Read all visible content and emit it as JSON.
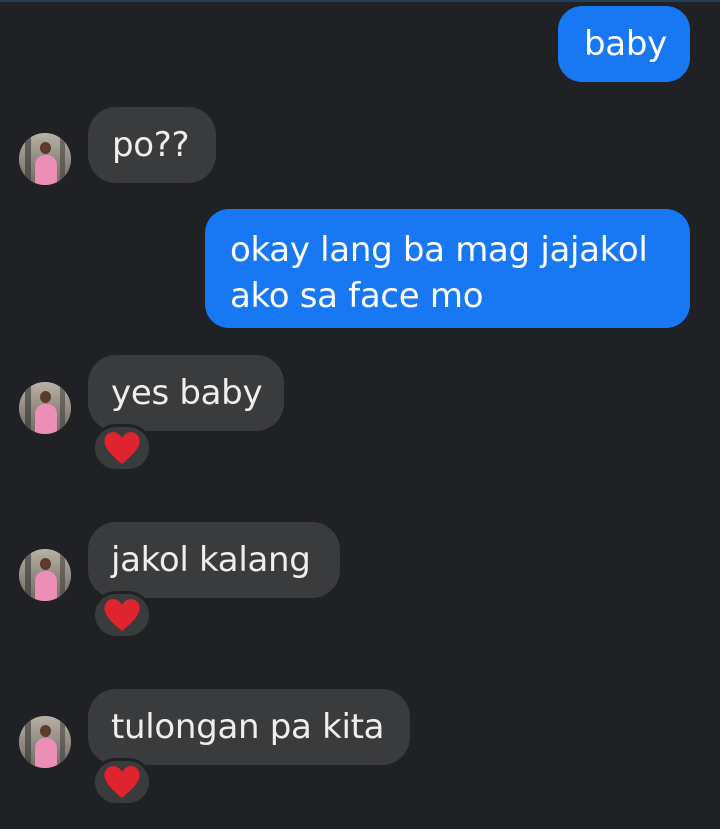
{
  "messages": [
    {
      "direction": "outgoing",
      "text": "baby"
    },
    {
      "direction": "incoming",
      "text": "po??"
    },
    {
      "direction": "outgoing",
      "text": "okay lang ba mag jajakol\nako sa face mo"
    },
    {
      "direction": "incoming",
      "text": "yes baby",
      "reaction": "heart-icon"
    },
    {
      "direction": "incoming",
      "text": "jakol kalang",
      "reaction": "heart-icon"
    },
    {
      "direction": "incoming",
      "text": "tulongan pa kita",
      "reaction": "heart-icon"
    }
  ],
  "colors": {
    "background": "#1f2124",
    "outgoing_bubble": "#1877f2",
    "incoming_bubble": "#3a3b3d",
    "reaction_heart": "#e0242f"
  }
}
